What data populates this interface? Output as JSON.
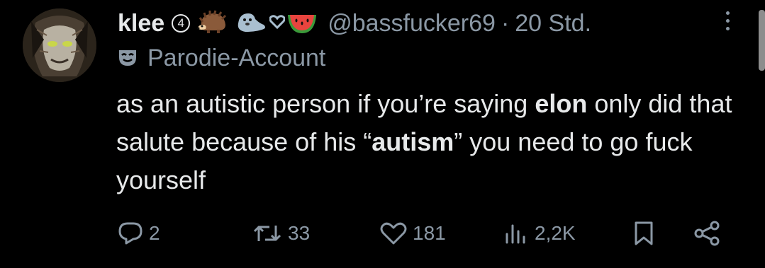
{
  "tweet": {
    "display_name": "klee",
    "badge_number": "4",
    "emojis": [
      "hedgehog-icon",
      "seal-icon",
      "watermelon-icon"
    ],
    "handle": "@bassfucker69",
    "separator": "·",
    "time": "20 Std.",
    "parody_label": "Parodie-Account",
    "text_parts": [
      "as an autistic person if you’re saying ",
      "elon",
      " only did that salute because of his “",
      "autism",
      "” you need to go fuck yourself"
    ]
  },
  "actions": {
    "replies": "2",
    "reposts": "33",
    "likes": "181",
    "views": "2,2K"
  },
  "colors": {
    "background": "#000000",
    "text": "#e7e9ea",
    "muted": "#8b98a5"
  }
}
